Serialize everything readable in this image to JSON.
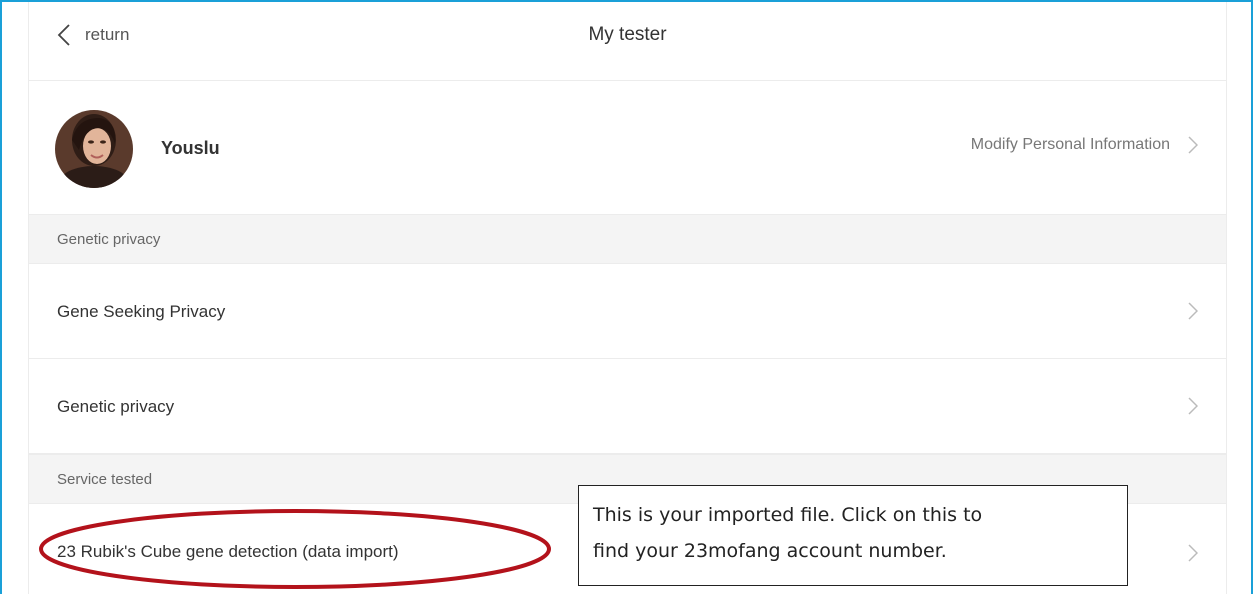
{
  "nav": {
    "back_label": "return",
    "title": "My tester"
  },
  "profile": {
    "username": "Youslu",
    "modify_label": "Modify Personal Information"
  },
  "sections": {
    "genetic_privacy_header": "Genetic privacy",
    "service_tested_header": "Service tested"
  },
  "rows": {
    "gene_seeking_privacy": "Gene Seeking Privacy",
    "genetic_privacy": "Genetic privacy",
    "rubiks_cube_import": "23 Rubik's Cube gene detection (data import)"
  },
  "annotation": {
    "line1": "This is your imported file. Click on this to",
    "line2": "find your 23mofang account number."
  },
  "colors": {
    "frame_border": "#1aa0d8",
    "annotation_ellipse": "#b3121b",
    "section_bg": "#f4f4f4"
  },
  "icons": {
    "back": "chevron-left-icon",
    "row_arrow": "chevron-right-icon"
  }
}
